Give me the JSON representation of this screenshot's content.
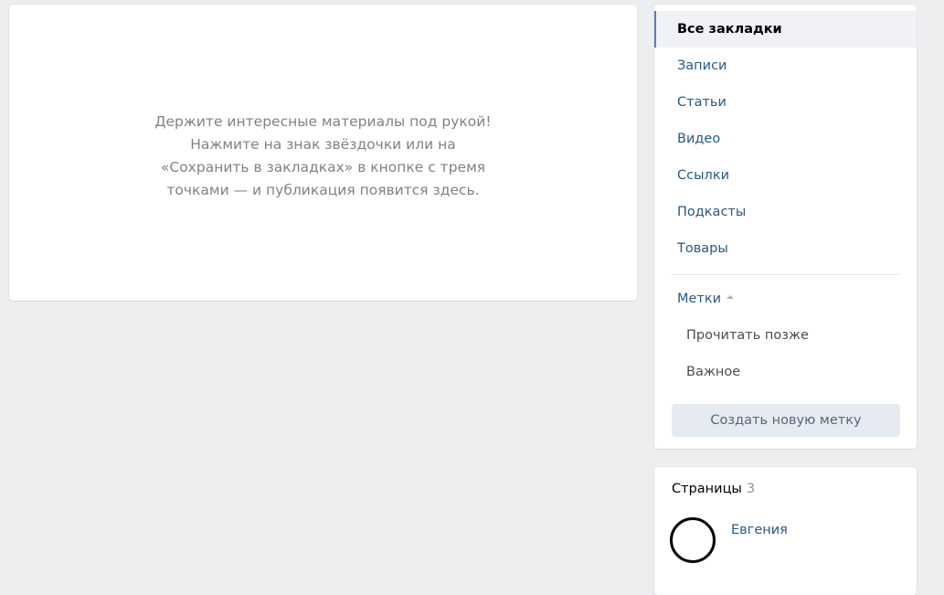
{
  "empty_state": {
    "line1": "Держите интересные материалы под рукой!",
    "line2": "Нажмите на знак звёздочки или на",
    "line3": "«Сохранить в закладках» в кнопке с тремя",
    "line4": "точками — и публикация появится здесь."
  },
  "menu": {
    "items": [
      {
        "label": "Все закладки",
        "active": true
      },
      {
        "label": "Записи"
      },
      {
        "label": "Статьи"
      },
      {
        "label": "Видео"
      },
      {
        "label": "Ссылки"
      },
      {
        "label": "Подкасты"
      },
      {
        "label": "Товары"
      }
    ],
    "tags_label": "Метки",
    "tags": [
      {
        "label": "Прочитать позже"
      },
      {
        "label": "Важное"
      }
    ],
    "create_tag_label": "Создать новую метку"
  },
  "pages": {
    "title": "Страницы",
    "count": "3",
    "items": [
      {
        "name": "Евгения"
      }
    ]
  },
  "colors": {
    "background": "#edeef0",
    "link": "#2a5885",
    "accent": "#5181b8",
    "button_bg": "#e5ebf1"
  }
}
